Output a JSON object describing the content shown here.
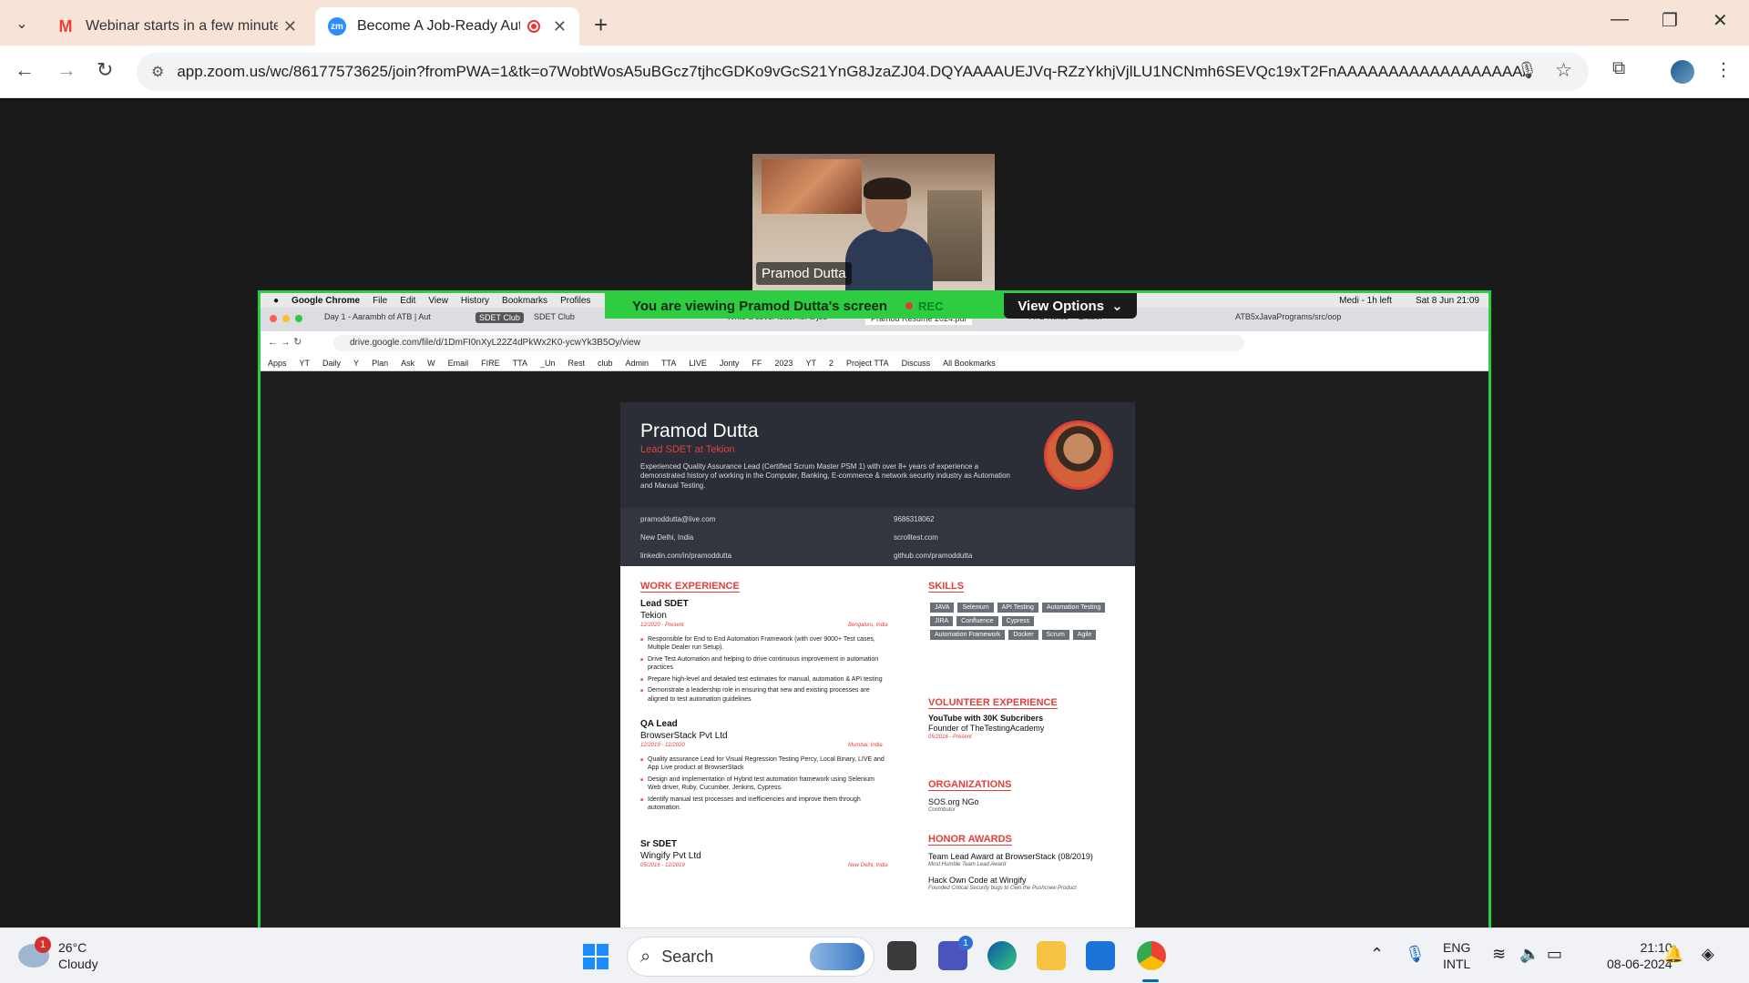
{
  "browser": {
    "tabs": [
      {
        "title": "Webinar starts in a few minutes",
        "favicon": "gmail-icon"
      },
      {
        "title": "Become A Job-Ready Autor",
        "favicon": "zoom-icon",
        "recording": true
      }
    ],
    "url": "app.zoom.us/wc/86177573625/join?fromPWA=1&tk=o7WobtWosA5uBGcz7tjhcGDKo9vGcS21YnG8JzaZJ04.DQYAAAAUEJVq-RZzYkhjVjlLU1NCNmh6SEVQc19xT2FnAAAAAAAAAAAAAAAAAAA..."
  },
  "zoom": {
    "participant_name": "Pramod Dutta",
    "viewing_label": "You are viewing  Pramod Dutta's screen",
    "rec_label": "REC",
    "view_options_label": "View Options"
  },
  "shared_screen": {
    "mac_menu": [
      "Google Chrome",
      "File",
      "Edit",
      "View",
      "History",
      "Bookmarks",
      "Profiles"
    ],
    "mac_status": {
      "timer": "Medi - 1h left",
      "datetime": "Sat 8 Jun 21:09"
    },
    "tabs": [
      "Day 1 - Aarambh of ATB | Aut",
      "SDET Club",
      "SDET Club",
      "Write a cover letter for a job",
      "Pramod Resume 2024.pdf",
      "ATB Notes -- Eraser",
      "ATB5xJavaPrograms/src/oop"
    ],
    "url": "drive.google.com/file/d/1DmFI0nXyL22Z4dPkWx2K0-ycwYk3B5Oy/view",
    "bookmarks": [
      "Apps",
      "YT",
      "Daily",
      "Y",
      "Plan",
      "Ask",
      "W",
      "Email",
      "FIRE",
      "TTA",
      "_Un",
      "Rest",
      "club",
      "Admin",
      "TTA",
      "LIVE",
      "Jonty",
      "FF",
      "2023",
      "YT",
      "2",
      "Project TTA",
      "Discuss",
      "All Bookmarks"
    ]
  },
  "resume": {
    "name": "Pramod Dutta",
    "role": "Lead SDET at Tekion",
    "summary": "Experienced Quality Assurance Lead (Certified Scrum Master PSM 1) with over 8+ years of experience a demonstrated history of working in the Computer, Banking, E-commerce & network security industry as Automation and Manual Testing.",
    "contact": {
      "email": "pramoddutta@live.com",
      "location": "New Delhi, India",
      "linkedin": "linkedin.com/in/pramoddutta",
      "phone": "9686318062",
      "website": "scrolltest.com",
      "github": "github.com/pramoddutta"
    },
    "sections": {
      "work": "WORK EXPERIENCE",
      "skills": "SKILLS",
      "volunteer": "VOLUNTEER EXPERIENCE",
      "organizations": "ORGANIZATIONS",
      "honors": "HONOR AWARDS"
    },
    "jobs": [
      {
        "title": "Lead SDET",
        "company": "Tekion",
        "dates": "12/2020 - Present",
        "location": "Bengaluru, India",
        "bullets": [
          "Responsible for End to End Automation Framework (with over 9000+ Test cases, Multiple Dealer run Setup).",
          "Drive Test Automation and helping to drive continuous improvement in automation practices",
          "Prepare high-level and detailed test estimates for manual, automation & API testing",
          "Demonstrate a leadership role in ensuring that new and existing processes are aligned to test automation guidelines"
        ]
      },
      {
        "title": "QA Lead",
        "company": "BrowserStack Pvt Ltd",
        "dates": "12/2019 - 12/2020",
        "location": "Mumbai, India",
        "bullets": [
          "Quality assurance Lead for Visual Regression Testing Percy, Local Binary, LIVE and App Live product at BrowserStack",
          "Design and implementation of Hybrid test automation framework using Selenium Web driver, Ruby, Cucumber, Jenkins, Cypress.",
          "Identify manual test processes and inefficiencies and improve them through automation."
        ]
      },
      {
        "title": "Sr SDET",
        "company": "Wingify Pvt Ltd",
        "dates": "05/2016 - 12/2019",
        "location": "New Delhi, India",
        "bullets": []
      }
    ],
    "skills": [
      "JAVA",
      "Selenium",
      "API Testing",
      "Automation Testing",
      "JIRA",
      "Confluence",
      "Cypress",
      "Automation Framework",
      "Docker",
      "Scrum",
      "Agile"
    ],
    "volunteer": {
      "title": "YouTube with 30K Subcribers",
      "org": "Founder of TheTestingAcademy",
      "dates": "05/2016 - Present"
    },
    "organization": {
      "name": "SOS.org NGo",
      "role": "Contributor"
    },
    "honors": [
      {
        "title": "Team Lead Award at BrowserStack (08/2019)",
        "note": "Most Humble Team Lead Award"
      },
      {
        "title": "Hack Own Code at Wingify",
        "note": "Founded Critical Security bugs to Own the Pushcrew Product"
      }
    ]
  },
  "taskbar": {
    "weather_temp": "26°C",
    "weather_desc": "Cloudy",
    "weather_badge": "1",
    "search_placeholder": "Search",
    "teams_badge": "1",
    "lang_top": "ENG",
    "lang_bottom": "INTL",
    "time": "21:10",
    "date": "08-06-2024"
  }
}
